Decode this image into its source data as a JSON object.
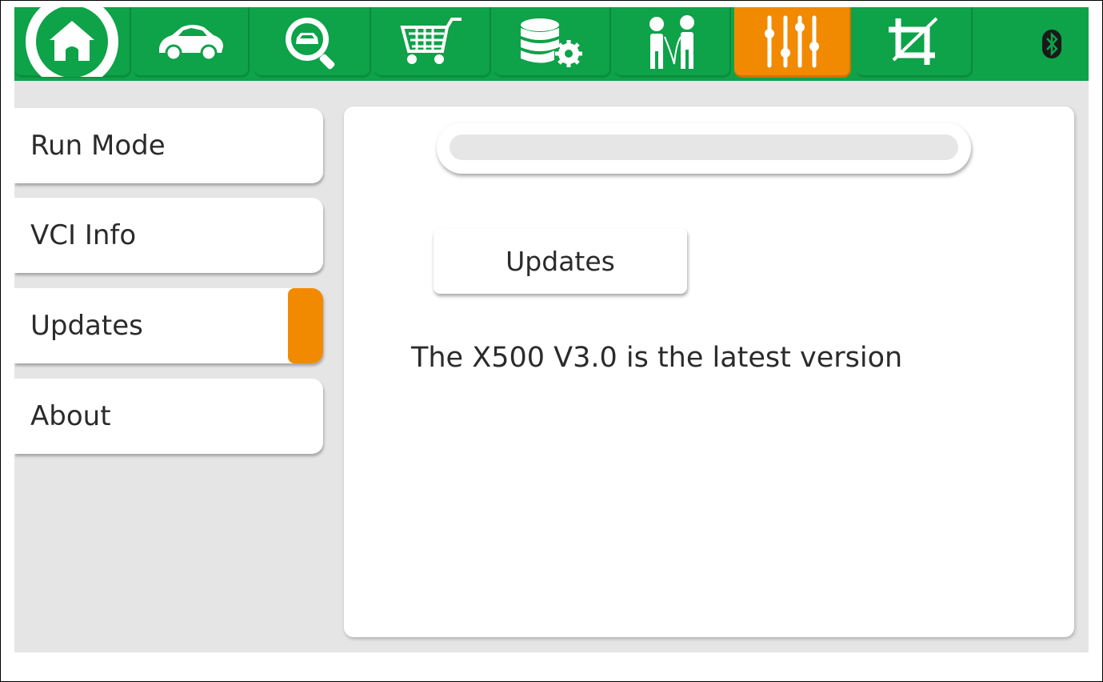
{
  "toolbar": {
    "tabs": [
      {
        "icon": "home-icon"
      },
      {
        "icon": "car-icon"
      },
      {
        "icon": "vehicle-search-icon"
      },
      {
        "icon": "shopping-cart-icon"
      },
      {
        "icon": "database-settings-icon"
      },
      {
        "icon": "people-chat-icon"
      },
      {
        "icon": "sliders-icon"
      },
      {
        "icon": "crop-icon"
      }
    ],
    "active_tab": 6,
    "status_icon": "bluetooth-icon"
  },
  "sidebar": {
    "items": [
      {
        "label": "Run Mode"
      },
      {
        "label": "VCI Info"
      },
      {
        "label": "Updates"
      },
      {
        "label": "About"
      }
    ],
    "selected": 2
  },
  "main": {
    "progress": 0,
    "update_button_label": "Updates",
    "status_message": "The X500 V3.0 is the latest version"
  },
  "colors": {
    "accent_green": "#0ea249",
    "accent_orange": "#f18a00",
    "background": "#e5e5e5",
    "panel": "#ffffff"
  }
}
